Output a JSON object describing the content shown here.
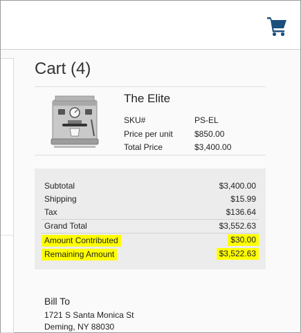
{
  "header": {
    "cart_icon": "shopping-cart-icon",
    "accent_color": "#1d4f7c"
  },
  "page": {
    "title": "Cart (4)"
  },
  "product": {
    "name": "The Elite",
    "image": "espresso-machine-image",
    "details": [
      {
        "label": "SKU#",
        "value": "PS-EL"
      },
      {
        "label": "Price per unit",
        "value": "$850.00"
      },
      {
        "label": "Total Price",
        "value": "$3,400.00"
      }
    ]
  },
  "summary": {
    "rows": [
      {
        "label": "Subtotal",
        "value": "$3,400.00"
      },
      {
        "label": "Shipping",
        "value": "$15.99"
      },
      {
        "label": "Tax",
        "value": "$136.64"
      },
      {
        "label": "Grand Total",
        "value": "$3,552.63"
      },
      {
        "label": "Amount Contributed",
        "value": "$30.00",
        "highlighted": true
      },
      {
        "label": "Remaining Amount",
        "value": "$3,522.63",
        "highlighted": true
      }
    ],
    "highlight_color": "#ffff00"
  },
  "bill_to": {
    "title": "Bill To",
    "address_line1": "1721 S Santa Monica St",
    "address_line2": "Deming, NY 88030"
  }
}
